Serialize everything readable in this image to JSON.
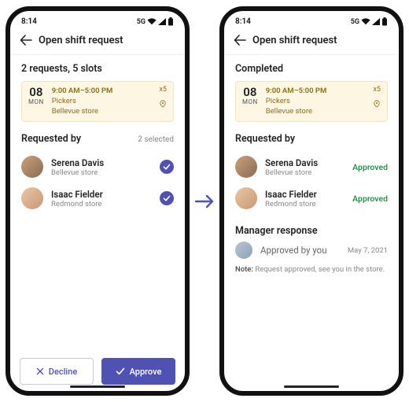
{
  "statusbar": {
    "time": "8:14",
    "net": "5G"
  },
  "header": {
    "title": "Open shift request"
  },
  "leftScreen": {
    "summary": "2 requests, 5 slots",
    "shift": {
      "day": "08",
      "dow": "MON",
      "time": "9:00 AM–5:00 PM",
      "role": "Pickers",
      "location": "Bellevue store",
      "slots": "x5"
    },
    "requestedBy": {
      "label": "Requested by",
      "selected": "2 selected"
    },
    "people": [
      {
        "name": "Serena Davis",
        "store": "Bellevue store"
      },
      {
        "name": "Isaac Fielder",
        "store": "Redmond store"
      }
    ],
    "buttons": {
      "decline": "Decline",
      "approve": "Approve"
    }
  },
  "rightScreen": {
    "summary": "Completed",
    "shift": {
      "day": "08",
      "dow": "MON",
      "time": "9:00 AM–5:00 PM",
      "role": "Pickers",
      "location": "Bellevue store",
      "slots": "x5"
    },
    "requestedBy": {
      "label": "Requested by"
    },
    "people": [
      {
        "name": "Serena Davis",
        "store": "Bellevue store",
        "status": "Approved"
      },
      {
        "name": "Isaac Fielder",
        "store": "Redmond store",
        "status": "Approved"
      }
    ],
    "managerResponse": {
      "title": "Manager response",
      "text": "Approved by you",
      "date": "May 7, 2021",
      "notePrefix": "Note:",
      "note": "Request approved, see you in the store."
    }
  }
}
